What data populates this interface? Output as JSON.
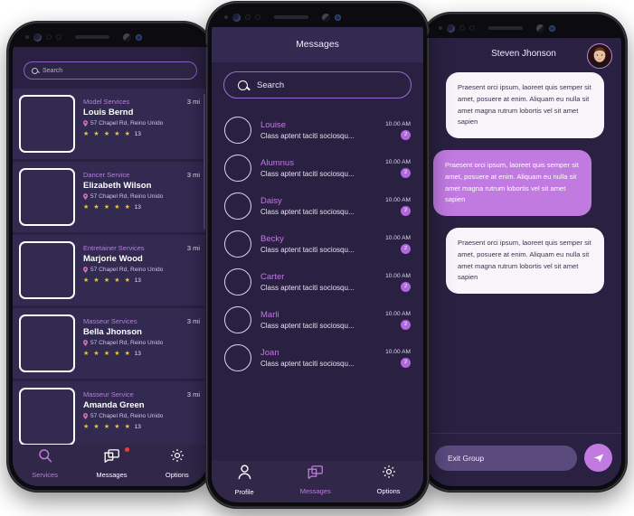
{
  "left_phone": {
    "search": {
      "placeholder": "Search",
      "icon": "search-icon"
    },
    "cards": [
      {
        "service": "Model Services",
        "name": "Louis Bernd",
        "address": "57 Chapel Rd, Reino Unido",
        "distance": "3 mi",
        "rating": "★ ★ ★ ★ ★",
        "reviews": "13"
      },
      {
        "service": "Dancer Service",
        "name": "Elizabeth Wilson",
        "address": "57 Chapel Rd, Reino Unido",
        "distance": "3 mi",
        "rating": "★ ★ ★ ★ ★",
        "reviews": "13"
      },
      {
        "service": "Entretainer Services",
        "name": "Marjorie Wood",
        "address": "57 Chapel Rd, Reino Unido",
        "distance": "3 mi",
        "rating": "★ ★ ★ ★ ★",
        "reviews": "13"
      },
      {
        "service": "Masseur Services",
        "name": "Bella Jhonson",
        "address": "57 Chapel Rd, Reino Unido",
        "distance": "3 mi",
        "rating": "★ ★ ★ ★ ★",
        "reviews": "13"
      },
      {
        "service": "Masseur Service",
        "name": "Amanda Green",
        "address": "57 Chapel Rd, Reino Unido",
        "distance": "3 mi",
        "rating": "★ ★ ★ ★ ★",
        "reviews": "13"
      }
    ],
    "nav": [
      {
        "label": "Services",
        "icon": "search-icon",
        "active": true,
        "badge": false
      },
      {
        "label": "Messages",
        "icon": "chat-icon",
        "active": false,
        "badge": true
      },
      {
        "label": "Options",
        "icon": "gear-icon",
        "active": false,
        "badge": false
      }
    ]
  },
  "center_phone": {
    "title": "Messages",
    "search": {
      "placeholder": "Search",
      "icon": "search-icon"
    },
    "conversations": [
      {
        "name": "Louise",
        "preview": "Class aptent taciti sociosqu...",
        "time": "10.00 AM",
        "unread": "2"
      },
      {
        "name": "Alumnus",
        "preview": "Class aptent taciti sociosqu...",
        "time": "10.00 AM",
        "unread": "2"
      },
      {
        "name": "Daisy",
        "preview": "Class aptent taciti sociosqu...",
        "time": "10.00 AM",
        "unread": "2"
      },
      {
        "name": "Becky",
        "preview": "Class aptent taciti sociosqu...",
        "time": "10.00 AM",
        "unread": "2"
      },
      {
        "name": "Carter",
        "preview": "Class aptent taciti sociosqu...",
        "time": "10.00 AM",
        "unread": "2"
      },
      {
        "name": "Marli",
        "preview": "Class aptent taciti sociosqu...",
        "time": "10.00 AM",
        "unread": "2"
      },
      {
        "name": "Joan",
        "preview": "Class aptent taciti sociosqu...",
        "time": "10.00 AM",
        "unread": "2"
      }
    ],
    "nav": [
      {
        "label": "Profile",
        "icon": "person-icon",
        "active": false
      },
      {
        "label": "Messages",
        "icon": "chat-icon",
        "active": true
      },
      {
        "label": "Options",
        "icon": "gear-icon",
        "active": false
      }
    ]
  },
  "right_phone": {
    "title": "Steven Jhonson",
    "messages": [
      {
        "from": "them",
        "text": "Praesent orci ipsum, laoreet quis semper sit amet, posuere at enim. Aliquam eu nulla sit amet magna rutrum lobortis vel sit amet sapien"
      },
      {
        "from": "me",
        "text": "Praesent orci ipsum, laoreet quis semper sit amet, posuere at enim. Aliquam eu nulla sit amet magna rutrum lobortis vel sit amet sapien"
      },
      {
        "from": "them",
        "text": "Praesent orci ipsum, laoreet quis semper sit amet, posuere at enim. Aliquam eu nulla sit amet magna rutrum lobortis vel sit amet sapien"
      }
    ],
    "composer": {
      "value": "Exit Group",
      "send_icon": "send-icon"
    }
  },
  "colors": {
    "screen_bg": "#2a2142",
    "card_bg": "#332a52",
    "accent": "#c07ae0",
    "accent_alt": "#b069dd",
    "text_light": "#efe8fa",
    "bubble_them": "#f7f4fa",
    "bubble_me": "#c07ae0",
    "badge_red": "#f03a3a",
    "star": "#e8c33c",
    "frame": "#0a0a0d"
  }
}
